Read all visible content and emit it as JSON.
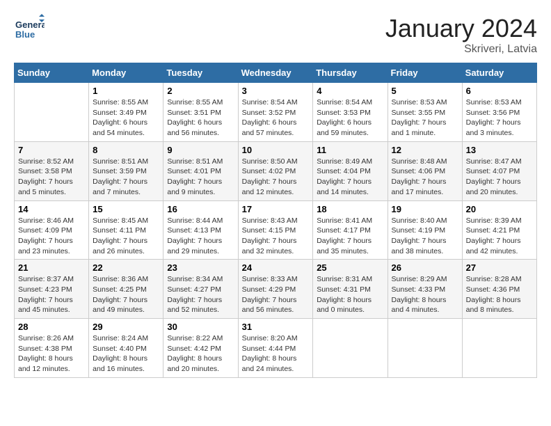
{
  "header": {
    "logo_line1": "General",
    "logo_line2": "Blue",
    "title": "January 2024",
    "subtitle": "Skriveri, Latvia"
  },
  "columns": [
    "Sunday",
    "Monday",
    "Tuesday",
    "Wednesday",
    "Thursday",
    "Friday",
    "Saturday"
  ],
  "weeks": [
    [
      {
        "day": "",
        "sunrise": "",
        "sunset": "",
        "daylight": ""
      },
      {
        "day": "1",
        "sunrise": "Sunrise: 8:55 AM",
        "sunset": "Sunset: 3:49 PM",
        "daylight": "Daylight: 6 hours and 54 minutes."
      },
      {
        "day": "2",
        "sunrise": "Sunrise: 8:55 AM",
        "sunset": "Sunset: 3:51 PM",
        "daylight": "Daylight: 6 hours and 56 minutes."
      },
      {
        "day": "3",
        "sunrise": "Sunrise: 8:54 AM",
        "sunset": "Sunset: 3:52 PM",
        "daylight": "Daylight: 6 hours and 57 minutes."
      },
      {
        "day": "4",
        "sunrise": "Sunrise: 8:54 AM",
        "sunset": "Sunset: 3:53 PM",
        "daylight": "Daylight: 6 hours and 59 minutes."
      },
      {
        "day": "5",
        "sunrise": "Sunrise: 8:53 AM",
        "sunset": "Sunset: 3:55 PM",
        "daylight": "Daylight: 7 hours and 1 minute."
      },
      {
        "day": "6",
        "sunrise": "Sunrise: 8:53 AM",
        "sunset": "Sunset: 3:56 PM",
        "daylight": "Daylight: 7 hours and 3 minutes."
      }
    ],
    [
      {
        "day": "7",
        "sunrise": "Sunrise: 8:52 AM",
        "sunset": "Sunset: 3:58 PM",
        "daylight": "Daylight: 7 hours and 5 minutes."
      },
      {
        "day": "8",
        "sunrise": "Sunrise: 8:51 AM",
        "sunset": "Sunset: 3:59 PM",
        "daylight": "Daylight: 7 hours and 7 minutes."
      },
      {
        "day": "9",
        "sunrise": "Sunrise: 8:51 AM",
        "sunset": "Sunset: 4:01 PM",
        "daylight": "Daylight: 7 hours and 9 minutes."
      },
      {
        "day": "10",
        "sunrise": "Sunrise: 8:50 AM",
        "sunset": "Sunset: 4:02 PM",
        "daylight": "Daylight: 7 hours and 12 minutes."
      },
      {
        "day": "11",
        "sunrise": "Sunrise: 8:49 AM",
        "sunset": "Sunset: 4:04 PM",
        "daylight": "Daylight: 7 hours and 14 minutes."
      },
      {
        "day": "12",
        "sunrise": "Sunrise: 8:48 AM",
        "sunset": "Sunset: 4:06 PM",
        "daylight": "Daylight: 7 hours and 17 minutes."
      },
      {
        "day": "13",
        "sunrise": "Sunrise: 8:47 AM",
        "sunset": "Sunset: 4:07 PM",
        "daylight": "Daylight: 7 hours and 20 minutes."
      }
    ],
    [
      {
        "day": "14",
        "sunrise": "Sunrise: 8:46 AM",
        "sunset": "Sunset: 4:09 PM",
        "daylight": "Daylight: 7 hours and 23 minutes."
      },
      {
        "day": "15",
        "sunrise": "Sunrise: 8:45 AM",
        "sunset": "Sunset: 4:11 PM",
        "daylight": "Daylight: 7 hours and 26 minutes."
      },
      {
        "day": "16",
        "sunrise": "Sunrise: 8:44 AM",
        "sunset": "Sunset: 4:13 PM",
        "daylight": "Daylight: 7 hours and 29 minutes."
      },
      {
        "day": "17",
        "sunrise": "Sunrise: 8:43 AM",
        "sunset": "Sunset: 4:15 PM",
        "daylight": "Daylight: 7 hours and 32 minutes."
      },
      {
        "day": "18",
        "sunrise": "Sunrise: 8:41 AM",
        "sunset": "Sunset: 4:17 PM",
        "daylight": "Daylight: 7 hours and 35 minutes."
      },
      {
        "day": "19",
        "sunrise": "Sunrise: 8:40 AM",
        "sunset": "Sunset: 4:19 PM",
        "daylight": "Daylight: 7 hours and 38 minutes."
      },
      {
        "day": "20",
        "sunrise": "Sunrise: 8:39 AM",
        "sunset": "Sunset: 4:21 PM",
        "daylight": "Daylight: 7 hours and 42 minutes."
      }
    ],
    [
      {
        "day": "21",
        "sunrise": "Sunrise: 8:37 AM",
        "sunset": "Sunset: 4:23 PM",
        "daylight": "Daylight: 7 hours and 45 minutes."
      },
      {
        "day": "22",
        "sunrise": "Sunrise: 8:36 AM",
        "sunset": "Sunset: 4:25 PM",
        "daylight": "Daylight: 7 hours and 49 minutes."
      },
      {
        "day": "23",
        "sunrise": "Sunrise: 8:34 AM",
        "sunset": "Sunset: 4:27 PM",
        "daylight": "Daylight: 7 hours and 52 minutes."
      },
      {
        "day": "24",
        "sunrise": "Sunrise: 8:33 AM",
        "sunset": "Sunset: 4:29 PM",
        "daylight": "Daylight: 7 hours and 56 minutes."
      },
      {
        "day": "25",
        "sunrise": "Sunrise: 8:31 AM",
        "sunset": "Sunset: 4:31 PM",
        "daylight": "Daylight: 8 hours and 0 minutes."
      },
      {
        "day": "26",
        "sunrise": "Sunrise: 8:29 AM",
        "sunset": "Sunset: 4:33 PM",
        "daylight": "Daylight: 8 hours and 4 minutes."
      },
      {
        "day": "27",
        "sunrise": "Sunrise: 8:28 AM",
        "sunset": "Sunset: 4:36 PM",
        "daylight": "Daylight: 8 hours and 8 minutes."
      }
    ],
    [
      {
        "day": "28",
        "sunrise": "Sunrise: 8:26 AM",
        "sunset": "Sunset: 4:38 PM",
        "daylight": "Daylight: 8 hours and 12 minutes."
      },
      {
        "day": "29",
        "sunrise": "Sunrise: 8:24 AM",
        "sunset": "Sunset: 4:40 PM",
        "daylight": "Daylight: 8 hours and 16 minutes."
      },
      {
        "day": "30",
        "sunrise": "Sunrise: 8:22 AM",
        "sunset": "Sunset: 4:42 PM",
        "daylight": "Daylight: 8 hours and 20 minutes."
      },
      {
        "day": "31",
        "sunrise": "Sunrise: 8:20 AM",
        "sunset": "Sunset: 4:44 PM",
        "daylight": "Daylight: 8 hours and 24 minutes."
      },
      {
        "day": "",
        "sunrise": "",
        "sunset": "",
        "daylight": ""
      },
      {
        "day": "",
        "sunrise": "",
        "sunset": "",
        "daylight": ""
      },
      {
        "day": "",
        "sunrise": "",
        "sunset": "",
        "daylight": ""
      }
    ]
  ]
}
